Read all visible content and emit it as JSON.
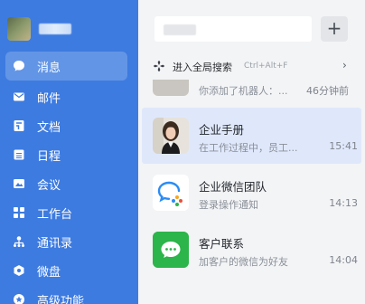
{
  "sidebar": {
    "items": [
      {
        "label": "消息",
        "icon": "message-icon",
        "active": true
      },
      {
        "label": "邮件",
        "icon": "mail-icon"
      },
      {
        "label": "文档",
        "icon": "document-icon"
      },
      {
        "label": "日程",
        "icon": "calendar-icon"
      },
      {
        "label": "会议",
        "icon": "meeting-icon"
      },
      {
        "label": "工作台",
        "icon": "workbench-icon"
      },
      {
        "label": "通讯录",
        "icon": "contacts-icon"
      },
      {
        "label": "微盘",
        "icon": "cloud-drive-icon"
      },
      {
        "label": "高级功能",
        "icon": "advanced-features-icon"
      }
    ]
  },
  "header": {
    "add_label": "+"
  },
  "global_search": {
    "label": "进入全局搜索",
    "shortcut": "Ctrl+Alt+F",
    "arrow": "›"
  },
  "conversations": {
    "partial_top": {
      "subtitle": "你添加了机器人：...",
      "time": "46分钟前"
    },
    "items": [
      {
        "title": "企业手册",
        "subtitle": "在工作过程中，员工...",
        "time": "15:41",
        "active": true,
        "icon": "person-avatar"
      },
      {
        "title": "企业微信团队",
        "subtitle": "登录操作通知",
        "time": "14:13",
        "icon": "wecom-logo-icon"
      },
      {
        "title": "客户联系",
        "subtitle": "加客户的微信为好友",
        "time": "14:04",
        "icon": "wechat-icon"
      }
    ]
  },
  "colors": {
    "sidebar": "#3d7be0",
    "accent": "#3d7be0",
    "wechat_green": "#2bb54a"
  }
}
